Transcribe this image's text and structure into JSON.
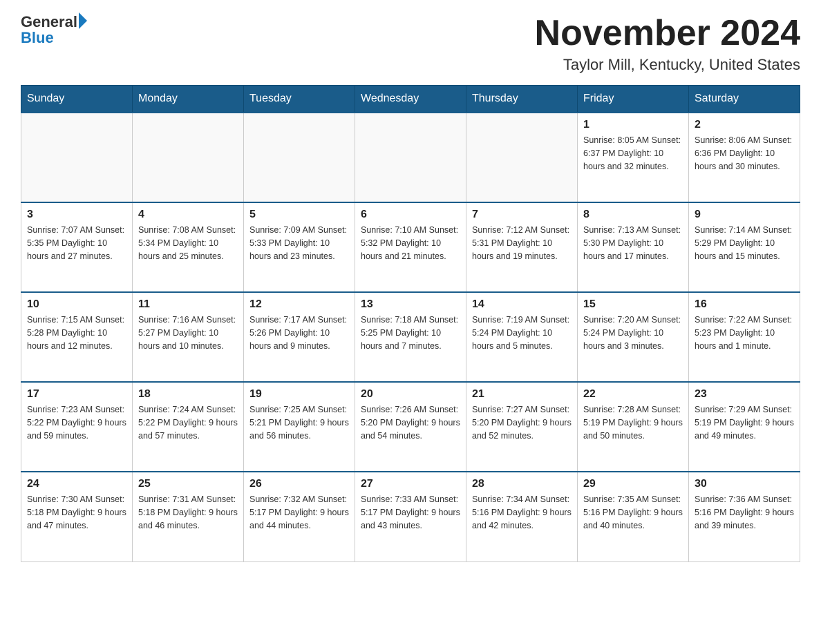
{
  "logo": {
    "general": "General",
    "blue": "Blue",
    "arrow": "▶"
  },
  "title": "November 2024",
  "subtitle": "Taylor Mill, Kentucky, United States",
  "days_header": [
    "Sunday",
    "Monday",
    "Tuesday",
    "Wednesday",
    "Thursday",
    "Friday",
    "Saturday"
  ],
  "weeks": [
    [
      {
        "day": "",
        "info": ""
      },
      {
        "day": "",
        "info": ""
      },
      {
        "day": "",
        "info": ""
      },
      {
        "day": "",
        "info": ""
      },
      {
        "day": "",
        "info": ""
      },
      {
        "day": "1",
        "info": "Sunrise: 8:05 AM\nSunset: 6:37 PM\nDaylight: 10 hours\nand 32 minutes."
      },
      {
        "day": "2",
        "info": "Sunrise: 8:06 AM\nSunset: 6:36 PM\nDaylight: 10 hours\nand 30 minutes."
      }
    ],
    [
      {
        "day": "3",
        "info": "Sunrise: 7:07 AM\nSunset: 5:35 PM\nDaylight: 10 hours\nand 27 minutes."
      },
      {
        "day": "4",
        "info": "Sunrise: 7:08 AM\nSunset: 5:34 PM\nDaylight: 10 hours\nand 25 minutes."
      },
      {
        "day": "5",
        "info": "Sunrise: 7:09 AM\nSunset: 5:33 PM\nDaylight: 10 hours\nand 23 minutes."
      },
      {
        "day": "6",
        "info": "Sunrise: 7:10 AM\nSunset: 5:32 PM\nDaylight: 10 hours\nand 21 minutes."
      },
      {
        "day": "7",
        "info": "Sunrise: 7:12 AM\nSunset: 5:31 PM\nDaylight: 10 hours\nand 19 minutes."
      },
      {
        "day": "8",
        "info": "Sunrise: 7:13 AM\nSunset: 5:30 PM\nDaylight: 10 hours\nand 17 minutes."
      },
      {
        "day": "9",
        "info": "Sunrise: 7:14 AM\nSunset: 5:29 PM\nDaylight: 10 hours\nand 15 minutes."
      }
    ],
    [
      {
        "day": "10",
        "info": "Sunrise: 7:15 AM\nSunset: 5:28 PM\nDaylight: 10 hours\nand 12 minutes."
      },
      {
        "day": "11",
        "info": "Sunrise: 7:16 AM\nSunset: 5:27 PM\nDaylight: 10 hours\nand 10 minutes."
      },
      {
        "day": "12",
        "info": "Sunrise: 7:17 AM\nSunset: 5:26 PM\nDaylight: 10 hours\nand 9 minutes."
      },
      {
        "day": "13",
        "info": "Sunrise: 7:18 AM\nSunset: 5:25 PM\nDaylight: 10 hours\nand 7 minutes."
      },
      {
        "day": "14",
        "info": "Sunrise: 7:19 AM\nSunset: 5:24 PM\nDaylight: 10 hours\nand 5 minutes."
      },
      {
        "day": "15",
        "info": "Sunrise: 7:20 AM\nSunset: 5:24 PM\nDaylight: 10 hours\nand 3 minutes."
      },
      {
        "day": "16",
        "info": "Sunrise: 7:22 AM\nSunset: 5:23 PM\nDaylight: 10 hours\nand 1 minute."
      }
    ],
    [
      {
        "day": "17",
        "info": "Sunrise: 7:23 AM\nSunset: 5:22 PM\nDaylight: 9 hours\nand 59 minutes."
      },
      {
        "day": "18",
        "info": "Sunrise: 7:24 AM\nSunset: 5:22 PM\nDaylight: 9 hours\nand 57 minutes."
      },
      {
        "day": "19",
        "info": "Sunrise: 7:25 AM\nSunset: 5:21 PM\nDaylight: 9 hours\nand 56 minutes."
      },
      {
        "day": "20",
        "info": "Sunrise: 7:26 AM\nSunset: 5:20 PM\nDaylight: 9 hours\nand 54 minutes."
      },
      {
        "day": "21",
        "info": "Sunrise: 7:27 AM\nSunset: 5:20 PM\nDaylight: 9 hours\nand 52 minutes."
      },
      {
        "day": "22",
        "info": "Sunrise: 7:28 AM\nSunset: 5:19 PM\nDaylight: 9 hours\nand 50 minutes."
      },
      {
        "day": "23",
        "info": "Sunrise: 7:29 AM\nSunset: 5:19 PM\nDaylight: 9 hours\nand 49 minutes."
      }
    ],
    [
      {
        "day": "24",
        "info": "Sunrise: 7:30 AM\nSunset: 5:18 PM\nDaylight: 9 hours\nand 47 minutes."
      },
      {
        "day": "25",
        "info": "Sunrise: 7:31 AM\nSunset: 5:18 PM\nDaylight: 9 hours\nand 46 minutes."
      },
      {
        "day": "26",
        "info": "Sunrise: 7:32 AM\nSunset: 5:17 PM\nDaylight: 9 hours\nand 44 minutes."
      },
      {
        "day": "27",
        "info": "Sunrise: 7:33 AM\nSunset: 5:17 PM\nDaylight: 9 hours\nand 43 minutes."
      },
      {
        "day": "28",
        "info": "Sunrise: 7:34 AM\nSunset: 5:16 PM\nDaylight: 9 hours\nand 42 minutes."
      },
      {
        "day": "29",
        "info": "Sunrise: 7:35 AM\nSunset: 5:16 PM\nDaylight: 9 hours\nand 40 minutes."
      },
      {
        "day": "30",
        "info": "Sunrise: 7:36 AM\nSunset: 5:16 PM\nDaylight: 9 hours\nand 39 minutes."
      }
    ]
  ]
}
